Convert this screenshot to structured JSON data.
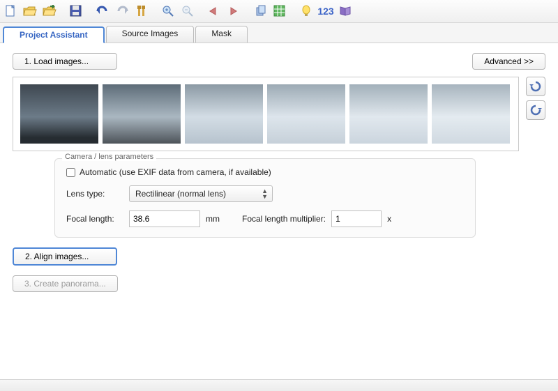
{
  "toolbar": {
    "new_icon": "new-file-icon",
    "open_icon": "open-folder-icon",
    "reopen_icon": "recent-folder-icon",
    "save_icon": "save-icon",
    "undo_icon": "undo-icon",
    "redo_icon": "redo-icon",
    "tools_icon": "tools-icon",
    "zoom_in_icon": "zoom-in-icon",
    "zoom_out_icon": "zoom-out-icon",
    "prev_icon": "arrow-left-icon",
    "next_icon": "arrow-right-icon",
    "copy_icon": "multi-page-icon",
    "grid_icon": "grid-icon",
    "tip_icon": "lightbulb-icon",
    "numbers_label": "123",
    "book_icon": "book-icon"
  },
  "tabs": {
    "project_assistant": "Project Assistant",
    "source_images": "Source Images",
    "mask": "Mask"
  },
  "buttons": {
    "load_images": "1. Load images...",
    "advanced": "Advanced >>",
    "align_images": "2. Align images...",
    "create_panorama": "3. Create panorama..."
  },
  "camera": {
    "group_title": "Camera / lens parameters",
    "automatic_label": "Automatic (use EXIF data from camera, if available)",
    "lens_type_label": "Lens type:",
    "lens_type_value": "Rectilinear (normal lens)",
    "focal_length_label": "Focal length:",
    "focal_length_value": "38.6",
    "mm_label": "mm",
    "multiplier_label": "Focal length multiplier:",
    "multiplier_value": "1",
    "x_label": "x"
  },
  "side": {
    "rotate_ccw_icon": "rotate-ccw-icon",
    "rotate_cw_icon": "rotate-cw-icon"
  }
}
